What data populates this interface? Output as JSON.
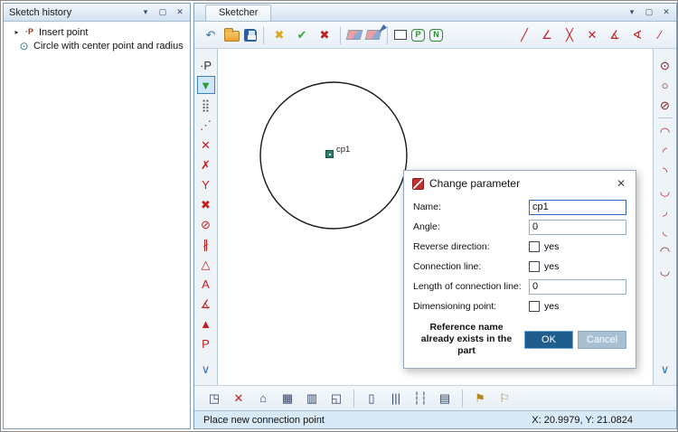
{
  "chrome": {
    "rollup": "▾",
    "maximize": "▢",
    "close": "✕"
  },
  "history_panel": {
    "title": "Sketch history",
    "expander": "▸",
    "items": [
      {
        "icon_name": "insert-point-icon",
        "icon_glyph": "·P",
        "label": "Insert point"
      },
      {
        "icon_name": "circle-item-icon",
        "icon_glyph": "⊙",
        "label": "Circle with center point and radius"
      }
    ]
  },
  "sketcher": {
    "title": "Sketcher",
    "status_left": "Place new connection point",
    "status_right": "X: 20.9979, Y: 21.0824",
    "point_label": "cp1"
  },
  "toolbar_top": {
    "items": [
      {
        "name": "undo-icon",
        "glyph": "↶",
        "color": "#3a6ea5"
      },
      {
        "name": "open-file-icon",
        "shape": "folder"
      },
      {
        "name": "save-icon",
        "shape": "floppy"
      },
      {
        "name": "separator"
      },
      {
        "name": "discard-changes-icon",
        "glyph": "✖",
        "color": "#d9a820"
      },
      {
        "name": "accept-icon",
        "glyph": "✔",
        "color": "#3fa53f"
      },
      {
        "name": "cancel-icon",
        "glyph": "✖",
        "color": "#c02020"
      },
      {
        "name": "separator"
      },
      {
        "name": "eraser-icon",
        "shape": "eraser"
      },
      {
        "name": "eraser-pen-icon",
        "shape": "eraser2"
      },
      {
        "name": "separator"
      },
      {
        "name": "rectangle-tool-icon",
        "shape": "rect"
      },
      {
        "name": "hexagon-p-tool-icon",
        "glyph": "P",
        "shape": "hex",
        "color": "#2e8b2e"
      },
      {
        "name": "hexagon-n-tool-icon",
        "glyph": "N",
        "shape": "hex",
        "color": "#2e8b2e"
      },
      {
        "name": "spacer"
      },
      {
        "name": "line-tool-icon",
        "glyph": "╱",
        "color": "#c02020"
      },
      {
        "name": "line-angle-tool-icon",
        "glyph": "∠",
        "color": "#c02020"
      },
      {
        "name": "line-cross-tool-icon",
        "glyph": "╳",
        "color": "#c02020"
      },
      {
        "name": "line-intersect-tool-icon",
        "glyph": "✕",
        "color": "#c02020"
      },
      {
        "name": "angle-arc-tool-icon",
        "glyph": "∡",
        "color": "#c02020"
      },
      {
        "name": "angle-measure-tool-icon",
        "glyph": "∢",
        "color": "#c02020"
      },
      {
        "name": "line-free-tool-icon",
        "glyph": "∕",
        "color": "#c02020"
      }
    ]
  },
  "toolbar_left": {
    "items": [
      {
        "name": "named-point-icon",
        "glyph": "·P",
        "color": "#333333"
      },
      {
        "name": "insert-point-icon",
        "glyph": "▼",
        "color": "#2f9e2f",
        "selected": true
      },
      {
        "name": "point-grid-icon",
        "glyph": "⣿",
        "color": "#555555"
      },
      {
        "name": "point-row-icon",
        "glyph": "⋰",
        "color": "#b03030"
      },
      {
        "name": "point-cross-icon",
        "glyph": "✕",
        "color": "#c02020"
      },
      {
        "name": "cross-marks-icon",
        "glyph": "✗",
        "color": "#c02020"
      },
      {
        "name": "fork-point-icon",
        "glyph": "Y",
        "color": "#c02020"
      },
      {
        "name": "cross-lines-icon",
        "glyph": "✖",
        "color": "#c02020"
      },
      {
        "name": "line-circle-icon",
        "glyph": "⊘",
        "color": "#c02020"
      },
      {
        "name": "hatch-line-icon",
        "glyph": "∦",
        "color": "#c02020"
      },
      {
        "name": "triangle-outline-icon",
        "glyph": "△",
        "color": "#c02020"
      },
      {
        "name": "text-underline-icon",
        "glyph": "A",
        "color": "#c02020"
      },
      {
        "name": "text-angle-icon",
        "glyph": "∡",
        "color": "#c02020"
      },
      {
        "name": "triangle-filled-icon",
        "glyph": "▲",
        "color": "#c02020"
      },
      {
        "name": "point-ref-icon",
        "glyph": "P",
        "color": "#c02020"
      },
      {
        "name": "spacer"
      },
      {
        "name": "more-tools-icon",
        "glyph": "∨",
        "color": "#2f6fae"
      }
    ]
  },
  "toolbar_right": {
    "items": [
      {
        "name": "circle-center-radius-icon",
        "glyph": "⊙",
        "color": "#7a1515"
      },
      {
        "name": "circle-icon",
        "glyph": "○",
        "color": "#7a1515"
      },
      {
        "name": "circle-tangent-icon",
        "glyph": "⊘",
        "color": "#7a1515"
      },
      {
        "name": "separator"
      },
      {
        "name": "arc-icon",
        "glyph": "◠",
        "color": "#c02020"
      },
      {
        "name": "arc-quadrant-icon",
        "glyph": "◜",
        "color": "#c02020"
      },
      {
        "name": "arc-quadrant2-icon",
        "glyph": "◝",
        "color": "#c02020"
      },
      {
        "name": "arc-lower-icon",
        "glyph": "◡",
        "color": "#c02020"
      },
      {
        "name": "arc-corner-icon",
        "glyph": "◞",
        "color": "#c02020"
      },
      {
        "name": "arc-corner2-icon",
        "glyph": "◟",
        "color": "#c02020"
      },
      {
        "name": "arc-small-icon",
        "glyph": "◠",
        "color": "#8b1a1a"
      },
      {
        "name": "arc-half-icon",
        "glyph": "◡",
        "color": "#8b1a1a"
      },
      {
        "name": "spacer"
      },
      {
        "name": "more-arcs-icon",
        "glyph": "∨",
        "color": "#2f6fae"
      }
    ]
  },
  "toolbar_bottom": {
    "items": [
      {
        "name": "zoom-window-icon",
        "glyph": "◳",
        "color": "#334466"
      },
      {
        "name": "zoom-delete-icon",
        "glyph": "✕",
        "color": "#c02020"
      },
      {
        "name": "pan-icon",
        "glyph": "⌂",
        "color": "#334466"
      },
      {
        "name": "grid-view-icon",
        "glyph": "▦",
        "color": "#334466"
      },
      {
        "name": "grid-flag-icon",
        "glyph": "▥",
        "color": "#334466"
      },
      {
        "name": "zoom-extent-icon",
        "glyph": "◱",
        "color": "#334466"
      },
      {
        "name": "separator"
      },
      {
        "name": "page-icon",
        "glyph": "▯",
        "color": "#334466"
      },
      {
        "name": "bars-icon",
        "glyph": "|||",
        "color": "#334466"
      },
      {
        "name": "dashed-bars-icon",
        "glyph": "┆┆",
        "color": "#334466"
      },
      {
        "name": "printer-icon",
        "glyph": "▤",
        "color": "#334466"
      },
      {
        "name": "separator"
      },
      {
        "name": "callout-icon",
        "glyph": "⚑",
        "color": "#b08a20"
      },
      {
        "name": "callout2-icon",
        "glyph": "⚐",
        "color": "#b08a20"
      }
    ]
  },
  "dialog": {
    "title": "Change parameter",
    "rows": [
      {
        "label": "Name:",
        "type": "text",
        "value": "cp1"
      },
      {
        "label": "Angle:",
        "type": "text",
        "value": "0"
      },
      {
        "label": "Reverse direction:",
        "type": "checkbox",
        "option": "yes",
        "checked": false
      },
      {
        "label": "Connection line:",
        "type": "checkbox",
        "option": "yes",
        "checked": false
      },
      {
        "label": "Length of connection line:",
        "type": "text",
        "value": "0"
      },
      {
        "label": "Dimensioning point:",
        "type": "checkbox",
        "option": "yes",
        "checked": false
      }
    ],
    "note": "Reference name already exists in the part",
    "ok_label": "OK",
    "cancel_label": "Cancel"
  }
}
